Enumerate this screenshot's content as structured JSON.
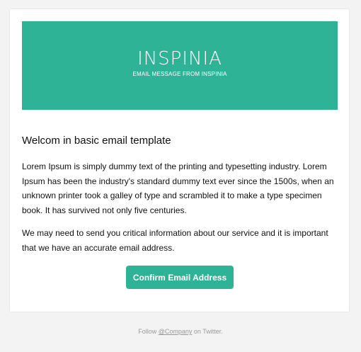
{
  "banner": {
    "title": "INSPINIA",
    "subtitle": "EMAIL MESSAGE FROM INSPINIA",
    "color": "#2fb397"
  },
  "email": {
    "heading": "Welcom in basic email template",
    "paragraph1": "Lorem Ipsum is simply dummy text of the printing and typesetting industry. Lorem Ipsum has been the industry's standard dummy text ever since the 1500s, when an unknown printer took a galley of type and scrambled it to make a type specimen book. It has survived not only five centuries.",
    "paragraph2": "We may need to send you critical information about our service and it is important that we have an accurate email address.",
    "button_label": "Confirm Email Address"
  },
  "footer": {
    "prefix": "Follow ",
    "link": "@Company",
    "suffix": " on Twitter."
  }
}
